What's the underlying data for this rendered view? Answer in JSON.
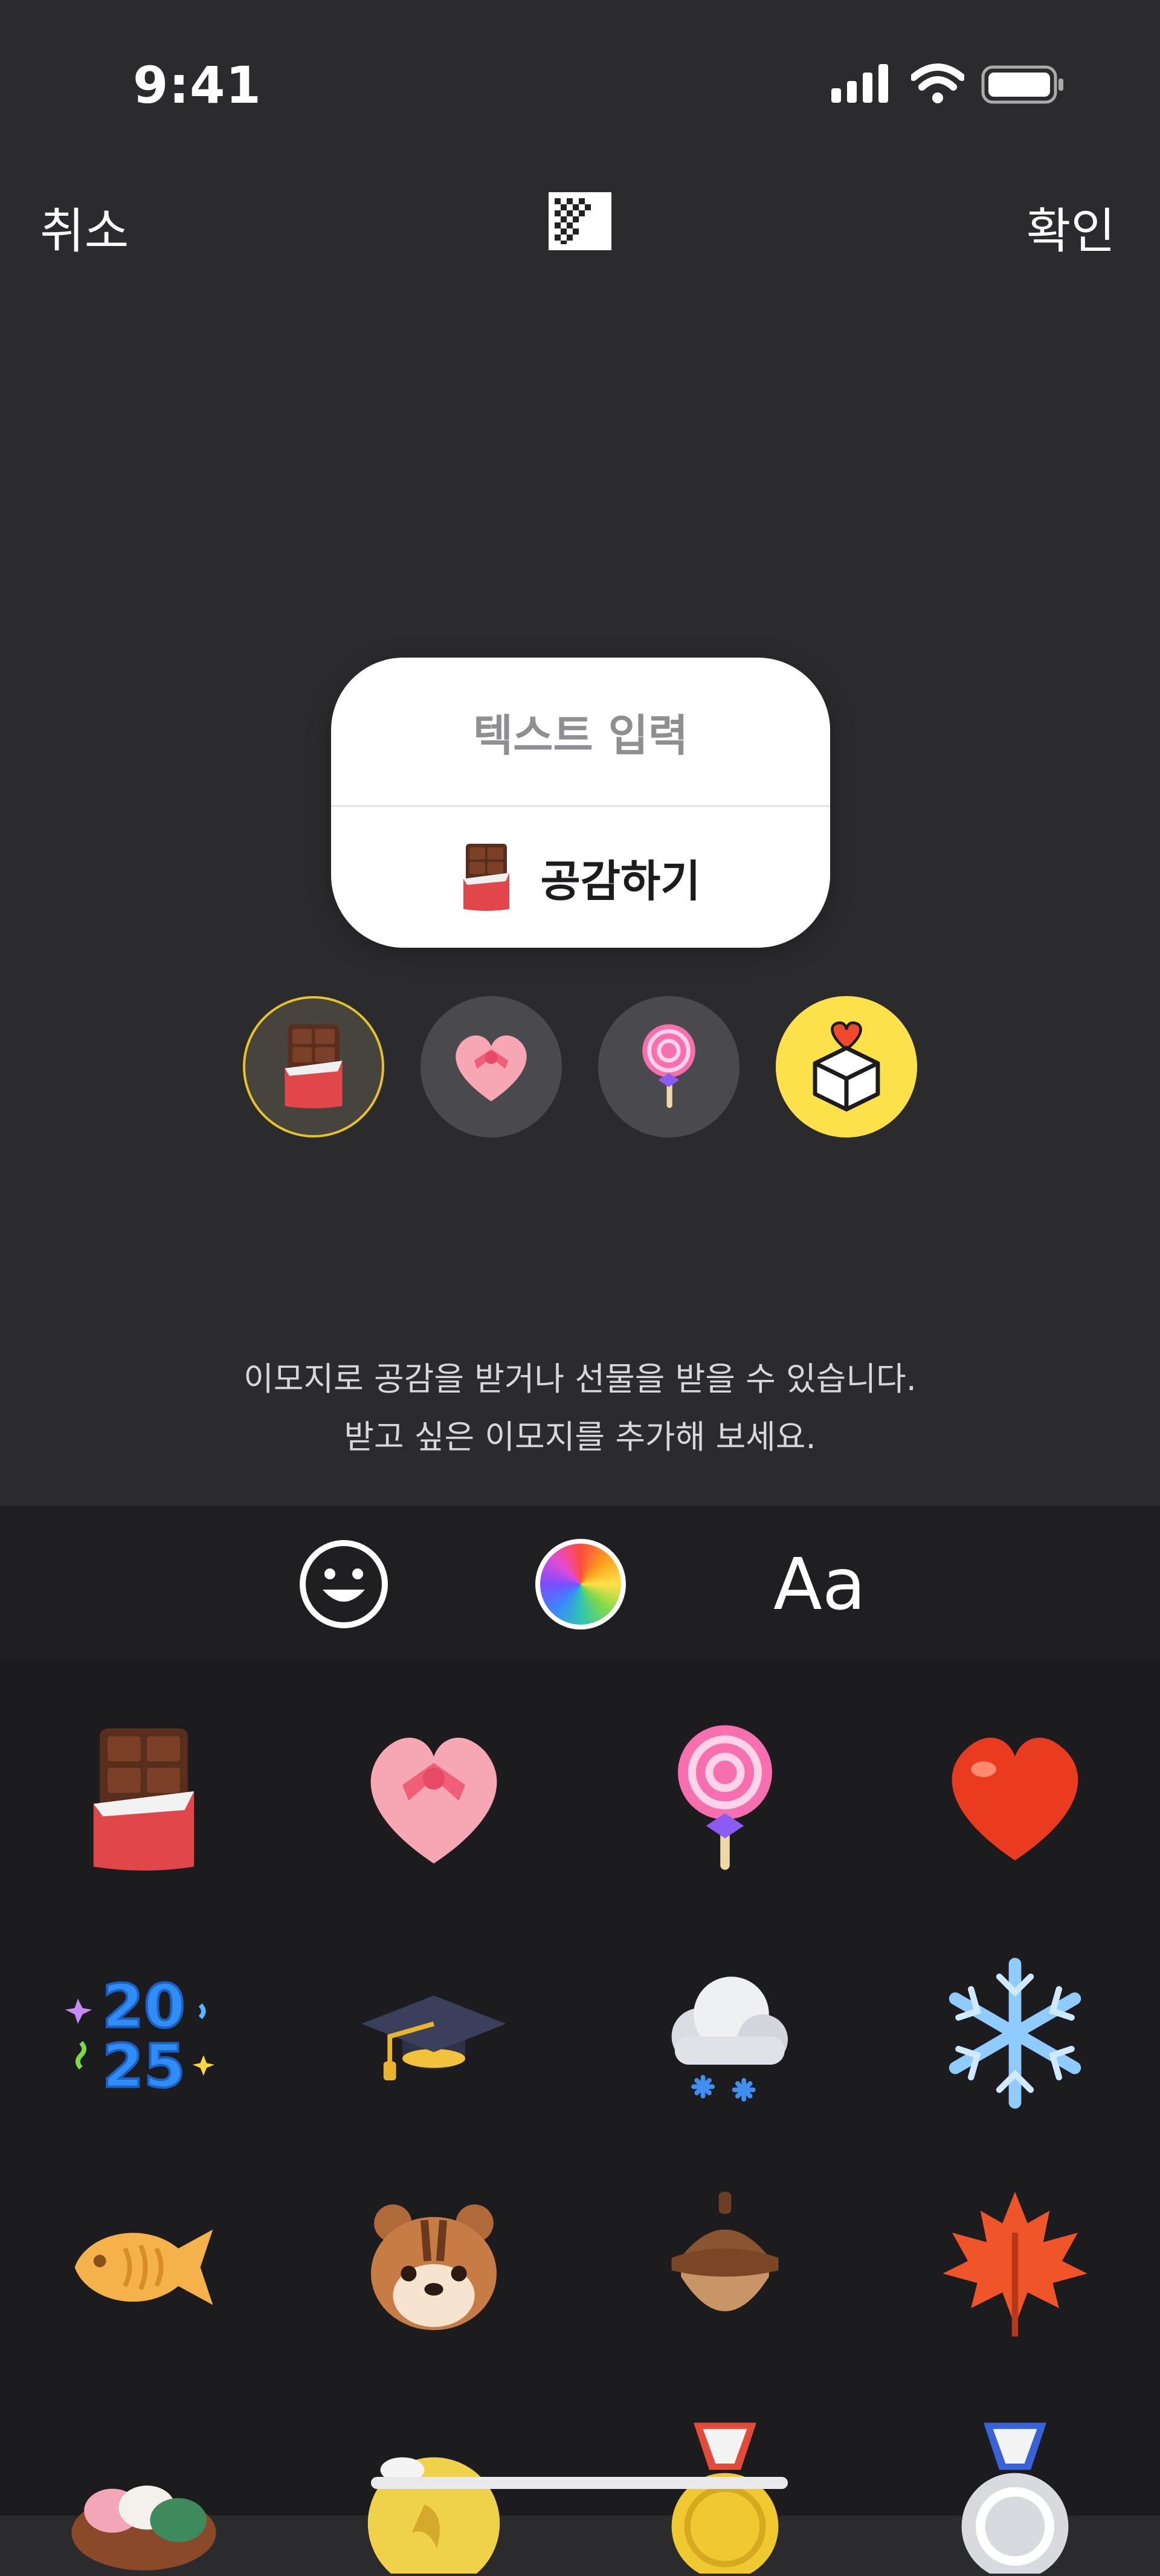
{
  "status_bar": {
    "time": "9:41"
  },
  "header": {
    "cancel_label": "취소",
    "confirm_label": "확인",
    "background_toggle_icon": "checkerboard-icon"
  },
  "card": {
    "placeholder": "텍스트 입력",
    "reaction_label": "공감하기",
    "reaction_icon": "chocolate-bar-icon"
  },
  "selector": [
    {
      "icon": "chocolate-bar-icon",
      "selected": true
    },
    {
      "icon": "heart-gift-box-icon",
      "selected": false
    },
    {
      "icon": "lollipop-icon",
      "selected": false
    },
    {
      "icon": "gift-box-heart-icon",
      "selected": false
    }
  ],
  "helper": {
    "line1": "이모지로 공감을 받거나 선물을 받을 수 있습니다.",
    "line2": "받고 싶은 이모지를 추가해 보세요."
  },
  "toolbar": {
    "emoji_tab_icon": "smiley-icon",
    "color_tab_icon": "color-wheel-icon",
    "font_tab_label": "Aa"
  },
  "emoji_grid": [
    "chocolate-bar-icon",
    "heart-gift-box-icon",
    "lollipop-icon",
    "red-heart-icon",
    "2025-icon",
    "graduation-cap-icon",
    "snow-cloud-icon",
    "snowflake-icon",
    "fish-bread-icon",
    "chipmunk-icon",
    "acorn-icon",
    "maple-leaf-icon",
    "songpyeon-icon",
    "gold-medal-icon",
    "gold-coin-medal-icon",
    "silver-medal-icon"
  ],
  "colors": {
    "background": "#2b2b2e",
    "accent_yellow": "#fde14a",
    "card": "#ffffff"
  }
}
